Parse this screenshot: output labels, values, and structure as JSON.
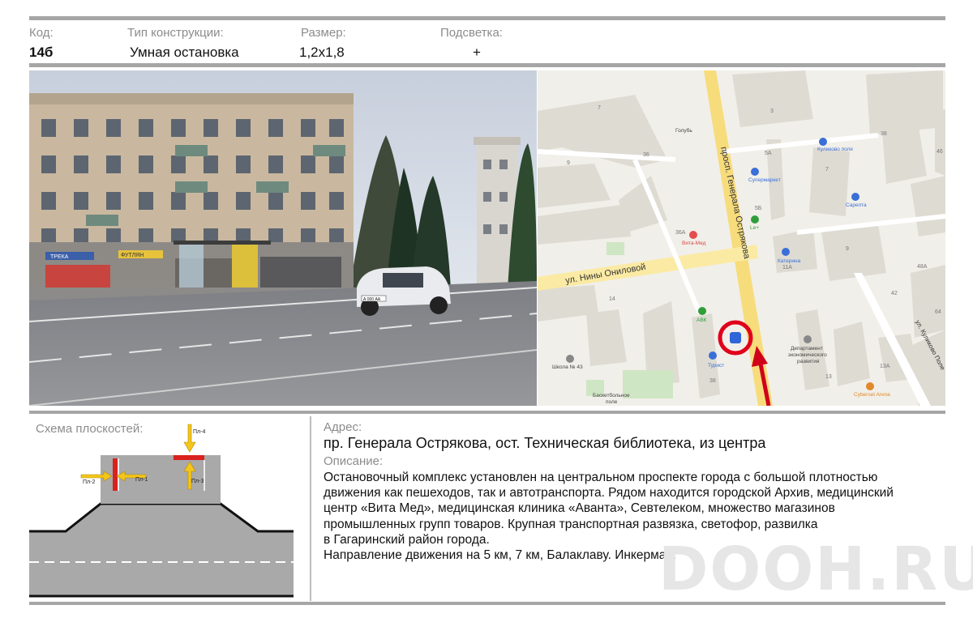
{
  "header": {
    "code_label": "Код:",
    "code_value": "14б",
    "type_label": "Тип конструкции:",
    "type_value": "Умная остановка",
    "size_label": "Размер:",
    "size_value": "1,2х1,8",
    "light_label": "Подсветка:",
    "light_value": "+"
  },
  "photo": {
    "sign_labels": [
      "ТРЕКА",
      "ФУТЛЯН"
    ],
    "car_plate": "А 000 АА"
  },
  "map": {
    "street_main": "просп. Генерала Острякова",
    "street_cross": "ул. Нины Ониловой",
    "street_right": "ул. Куликово Поле",
    "places": [
      {
        "name": "Голубь"
      },
      {
        "name": "Куликово поле"
      },
      {
        "name": "Супермаркет"
      },
      {
        "name": "Сарепта"
      },
      {
        "name": "Le+"
      },
      {
        "name": "Вита-Мед"
      },
      {
        "name": "Катерина"
      },
      {
        "name": "АВК"
      },
      {
        "name": "Турист"
      },
      {
        "name": "Школа № 43"
      },
      {
        "name": "Баскетбольное"
      },
      {
        "name": "поле"
      },
      {
        "name": "Департамент"
      },
      {
        "name": "экономического"
      },
      {
        "name": "развития"
      },
      {
        "name": "Cyberset Arena"
      }
    ],
    "numbers": [
      "7",
      "3",
      "38",
      "46",
      "9",
      "36",
      "5А",
      "7",
      "5Б",
      "36А",
      "9",
      "11А",
      "48А",
      "14",
      "42",
      "64",
      "13",
      "13А",
      "38"
    ]
  },
  "scheme": {
    "title": "Схема плоскостей:",
    "planes": [
      "Пл-1",
      "Пл-2",
      "Пл-3",
      "Пл-4"
    ]
  },
  "address": {
    "label": "Адрес:",
    "value": "пр. Генерала Острякова, ост. Техническая библиотека, из центра"
  },
  "description": {
    "label": "Описание:",
    "lines": [
      "Остановочный комплекс установлен на центральном проспекте города с большой плотностью",
      "движения как пешеходов, так и автотранспорта. Рядом находится городской Архив, медицинский",
      "центр «Вита Мед», медицинская клиника «Аванта», Севтелеком, множество магазинов",
      "промышленных групп товаров. Крупная транспортная развязка, светофор, развилка",
      "в Гагаринский район города.",
      "Направление движения на 5 км, 7 км, Балаклаву. Инкерман."
    ]
  },
  "watermark": "DOOH.RU",
  "colors": {
    "rule": "#a6a6a6",
    "plane_red": "#d9211e",
    "arrow_yellow": "#f4c61b",
    "road_gray": "#a9a9a9",
    "map_street": "#f7dc7c",
    "marker_red": "#e0001b"
  }
}
